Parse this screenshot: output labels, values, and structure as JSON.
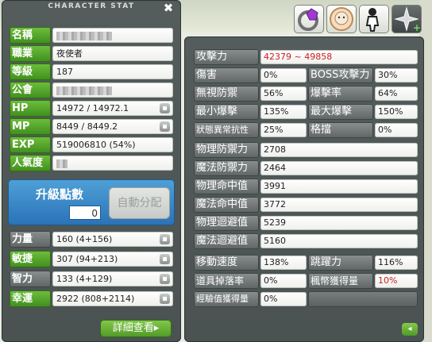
{
  "window_title": "CHARACTER STAT",
  "close_glyph": "✖",
  "basic": [
    {
      "label": "名稱",
      "value": ""
    },
    {
      "label": "職業",
      "value": "夜使者"
    },
    {
      "label": "等級",
      "value": "187"
    },
    {
      "label": "公會",
      "value": ""
    },
    {
      "label": "HP",
      "value": "14972 / 14972.1"
    },
    {
      "label": "MP",
      "value": "8449 / 8449.2"
    },
    {
      "label": "EXP",
      "value": "519006810 (54%)"
    },
    {
      "label": "人氣度",
      "value": ""
    }
  ],
  "ap": {
    "label": "升級點數",
    "value": "0",
    "auto_button": "自動分配"
  },
  "stats": [
    {
      "label": "力量",
      "value": "160 (4+156)"
    },
    {
      "label": "敏捷",
      "value": "307 (94+213)"
    },
    {
      "label": "智力",
      "value": "133 (4+129)"
    },
    {
      "label": "幸運",
      "value": "2922 (808+2114)"
    }
  ],
  "detail_button": "詳細查看▸",
  "detail": {
    "attack": {
      "label": "攻擊力",
      "value": "42379 ~ 49858"
    },
    "pairs": [
      {
        "l1": "傷害",
        "v1": "0%",
        "l2": "BOSS攻擊力",
        "v2": "30%"
      },
      {
        "l1": "無視防禦",
        "v1": "56%",
        "l2": "爆擊率",
        "v2": "64%"
      },
      {
        "l1": "最小爆擊",
        "v1": "135%",
        "l2": "最大爆擊",
        "v2": "150%"
      },
      {
        "l1": "狀態異常抗性",
        "v1": "25%",
        "l2": "格擋",
        "v2": "0%"
      }
    ],
    "singles": [
      {
        "label": "物理防禦力",
        "value": "2708"
      },
      {
        "label": "魔法防禦力",
        "value": "2464"
      },
      {
        "label": "物理命中值",
        "value": "3991"
      },
      {
        "label": "魔法命中值",
        "value": "3772"
      },
      {
        "label": "物理迴避值",
        "value": "5239"
      },
      {
        "label": "魔法迴避值",
        "value": "5160"
      }
    ],
    "pairs2": [
      {
        "l1": "移動速度",
        "v1": "138%",
        "l2": "跳躍力",
        "v2": "116%"
      },
      {
        "l1": "道具掉落率",
        "v1": "0%",
        "l2": "楓幣獲得量",
        "v2": "10%"
      }
    ],
    "exp_gain": {
      "label": "經驗值獲得量",
      "value": "0%"
    },
    "back_glyph": "◂"
  },
  "top_icons": [
    "ring-gem-icon",
    "character-portrait-icon",
    "character-silhouette-icon",
    "shuriken-icon"
  ]
}
